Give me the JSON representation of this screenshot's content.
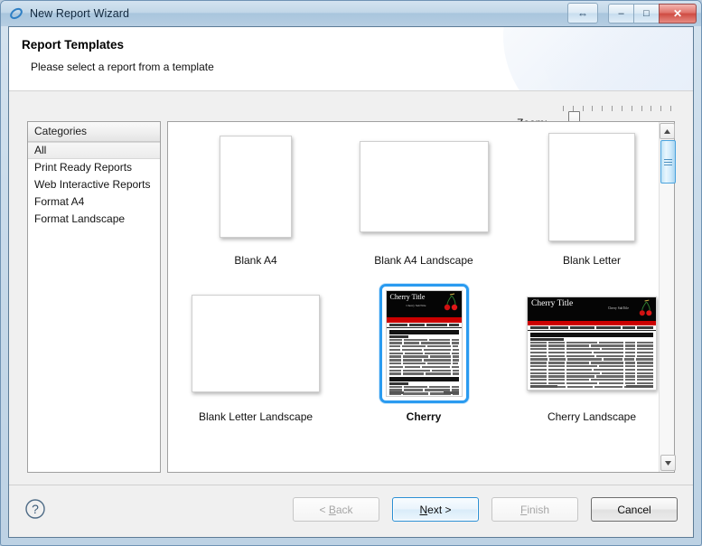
{
  "window": {
    "title": "New Report Wizard",
    "icon": "wizard-ellipse-icon",
    "buttons": {
      "resize": "⇔",
      "minimize": "–",
      "maximize": "□",
      "close": "✕"
    }
  },
  "header": {
    "title": "Report Templates",
    "subtitle": "Please select a report from a template"
  },
  "zoom": {
    "label": "Zoom:",
    "value": 10,
    "min": 0,
    "max": 100
  },
  "categories": {
    "header": "Categories",
    "items": [
      {
        "label": "All",
        "selected": true
      },
      {
        "label": "Print Ready Reports",
        "selected": false
      },
      {
        "label": "Web Interactive Reports",
        "selected": false
      },
      {
        "label": "Format A4",
        "selected": false
      },
      {
        "label": "Format Landscape",
        "selected": false
      }
    ]
  },
  "templates": {
    "items": [
      {
        "label": "Blank A4",
        "kind": "blank",
        "shape": "a4-portrait",
        "selected": false
      },
      {
        "label": "Blank A4 Landscape",
        "kind": "blank",
        "shape": "a4-landscape",
        "selected": false
      },
      {
        "label": "Blank Letter",
        "kind": "blank",
        "shape": "letter-portrait",
        "selected": false
      },
      {
        "label": "Blank Letter Landscape",
        "kind": "blank",
        "shape": "letter-landscape",
        "selected": false
      },
      {
        "label": "Cherry",
        "kind": "cherry",
        "shape": "cherry-portrait",
        "selected": true
      },
      {
        "label": "Cherry Landscape",
        "kind": "cherry",
        "shape": "cherry-landscape",
        "selected": false
      }
    ],
    "preview_doc": {
      "title": "Cherry Title",
      "subtitle": "Cherry SubTitle"
    }
  },
  "footer": {
    "help": "?",
    "back": "< Back",
    "back_mnemonic": "B",
    "next": "Next >",
    "next_mnemonic": "N",
    "finish": "Finish",
    "finish_mnemonic": "F",
    "cancel": "Cancel"
  },
  "colors": {
    "selection": "#2a9bf0",
    "cherry_band": "#cc0000",
    "cherry_header": "#050505",
    "close_button": "#cf4c43",
    "scroll_thumb": "#4aa3dd"
  }
}
